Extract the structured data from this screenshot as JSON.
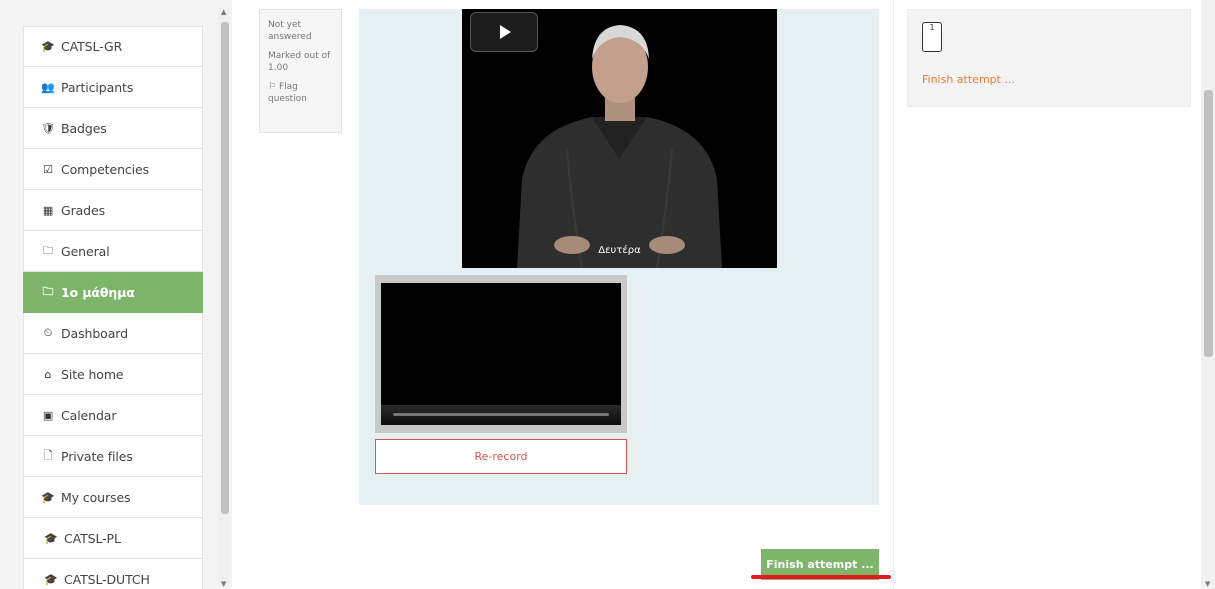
{
  "sidebar": {
    "items": [
      {
        "label": "CATSL-GR",
        "icon": "graduation-cap-icon",
        "glyph": "🎓",
        "active": false
      },
      {
        "label": "Participants",
        "icon": "users-icon",
        "glyph": "👥",
        "active": false
      },
      {
        "label": "Badges",
        "icon": "badge-icon",
        "glyph": "🛡",
        "active": false
      },
      {
        "label": "Competencies",
        "icon": "checkbox-icon",
        "glyph": "☑",
        "active": false
      },
      {
        "label": "Grades",
        "icon": "table-icon",
        "glyph": "▦",
        "active": false
      },
      {
        "label": "General",
        "icon": "folder-icon",
        "glyph": "🗀",
        "active": false
      },
      {
        "label": "1ο μάθημα",
        "icon": "folder-icon",
        "glyph": "🗀",
        "active": true
      },
      {
        "label": "Dashboard",
        "icon": "dashboard-icon",
        "glyph": "⏲",
        "active": false
      },
      {
        "label": "Site home",
        "icon": "home-icon",
        "glyph": "⌂",
        "active": false
      },
      {
        "label": "Calendar",
        "icon": "calendar-icon",
        "glyph": "▣",
        "active": false
      },
      {
        "label": "Private files",
        "icon": "file-icon",
        "glyph": "🗋",
        "active": false
      },
      {
        "label": "My courses",
        "icon": "graduation-cap-icon",
        "glyph": "🎓",
        "active": false
      },
      {
        "label": "CATSL-PL",
        "icon": "graduation-cap-icon",
        "glyph": "🎓",
        "active": false,
        "indent": true
      },
      {
        "label": "CATSL-DUTCH",
        "icon": "graduation-cap-icon",
        "glyph": "🎓",
        "active": false,
        "indent": true
      }
    ]
  },
  "question_info": {
    "state": "Not yet answered",
    "marks": "Marked out of 1.00",
    "flag": "Flag question",
    "flag_glyph": "⚐"
  },
  "video": {
    "caption": "Δευτέρα"
  },
  "recorder": {
    "rerecord_label": "Re-record"
  },
  "finish_button_label": "Finish attempt ...",
  "quiz_nav": {
    "question_number": "1",
    "finish_link": "Finish attempt ..."
  },
  "colors": {
    "accent_green": "#7fb56a",
    "rerecord_red": "#d9534f",
    "finish_link_orange": "#f0782f",
    "underline_red": "#e8191c"
  }
}
